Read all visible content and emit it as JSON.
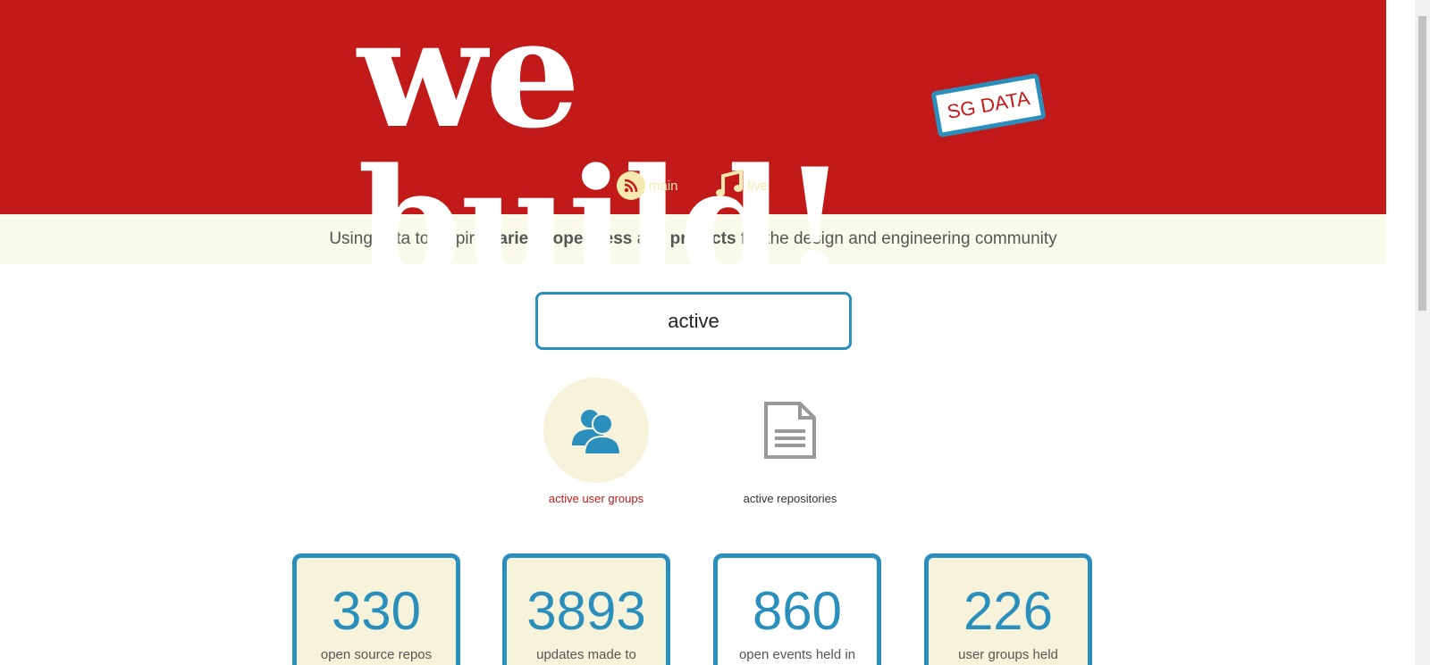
{
  "header": {
    "logo": "we build!",
    "stamp": "SG DATA",
    "nav": [
      {
        "label": "main",
        "icon": "rss-icon"
      },
      {
        "label": "live",
        "icon": "music-icon"
      }
    ]
  },
  "tagline": {
    "pre": "Using data to inspire ",
    "b1": "variety",
    "sep": ", ",
    "b2": "openness",
    "mid": " and ",
    "b3": "projects",
    "post": " for the design and engineering community"
  },
  "search": {
    "value": "active"
  },
  "options": [
    {
      "label": "active user groups",
      "selected": true
    },
    {
      "label": "active repositories",
      "selected": false
    }
  ],
  "stats": [
    {
      "value": "330",
      "label": "open source repos"
    },
    {
      "value": "3893",
      "label": "updates made to"
    },
    {
      "value": "860",
      "label": "open events held in"
    },
    {
      "value": "226",
      "label": "user groups held"
    }
  ],
  "colors": {
    "red": "#c11a19",
    "blue": "#2a8fbd",
    "cream": "#f7f3db"
  }
}
